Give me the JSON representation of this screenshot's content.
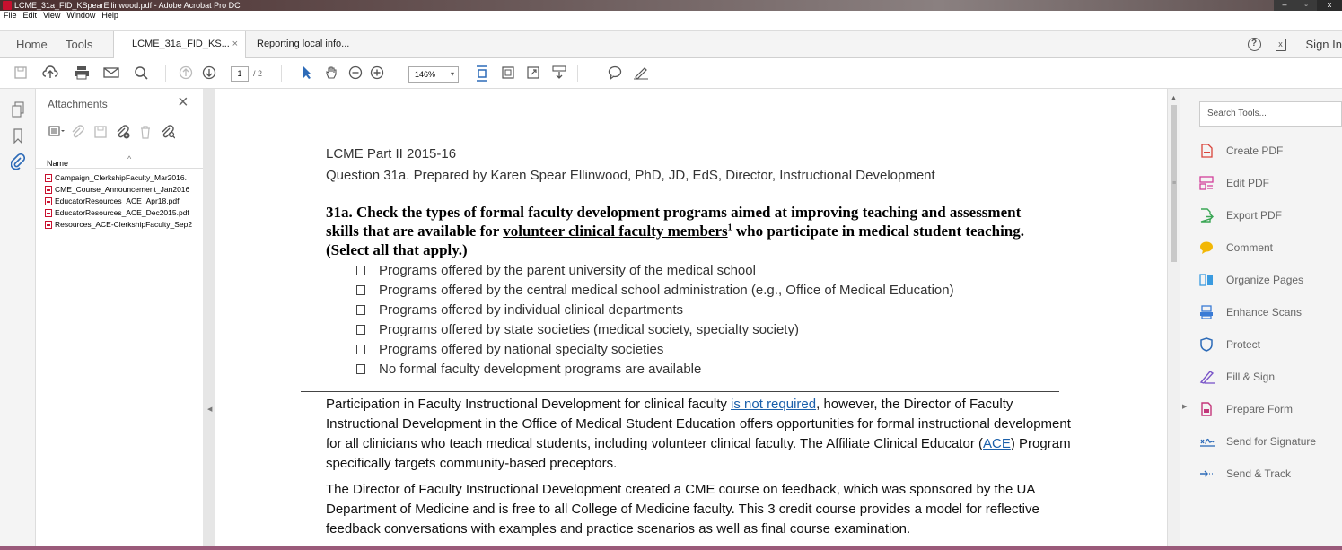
{
  "window": {
    "title": "LCME_31a_FID_KSpearEllinwood.pdf - Adobe Acrobat Pro DC",
    "controls": {
      "minimize": "–",
      "maximize": "▫",
      "close": "x"
    }
  },
  "menu": [
    "File",
    "Edit",
    "View",
    "Window",
    "Help"
  ],
  "tabs": {
    "home": "Home",
    "tools": "Tools",
    "active_doc": "LCME_31a_FID_KS...",
    "active_doc_close": "×",
    "other_doc": "Reporting local info...",
    "sign_in": "Sign In",
    "help_glyph": "?",
    "mobile_glyph": "x"
  },
  "toolbar": {
    "page_current": "1",
    "page_total": "/ 2",
    "zoom": "146%",
    "zoom_caret": "▾"
  },
  "attachments": {
    "title": "Attachments",
    "close": "×",
    "column_name": "Name",
    "sort_glyph": "^",
    "files": [
      "Campaign_ClerkshipFaculty_Mar2016.",
      "CME_Course_Announcement_Jan2016",
      "EducatorResources_ACE_Apr18.pdf",
      "EducatorResources_ACE_Dec2015.pdf",
      "Resources_ACE-ClerkshipFaculty_Sep2"
    ]
  },
  "document": {
    "heading1": "LCME Part II 2015-16",
    "heading2": "Question 31a. Prepared by Karen Spear Ellinwood, PhD, JD, EdS, Director, Instructional Development",
    "question_line1": "31a. Check the types of formal faculty development programs aimed at improving teaching and assessment",
    "question_line2_pre": "skills that are available for ",
    "question_line2_link": "volunteer clinical faculty members",
    "question_line2_sup": "1",
    "question_line2_post": " who participate in medical student teaching.",
    "question_line3": "(Select all that apply.)",
    "options": [
      "Programs offered by the parent university of the medical school",
      "Programs offered by the central medical school administration (e.g., Office of Medical Education)",
      "Programs offered by individual clinical departments",
      "Programs offered by state societies (medical society, specialty society)",
      "Programs offered by national specialty societies",
      "No formal faculty development programs are available"
    ],
    "para1_a": "Participation in Faculty Instructional Development for clinical faculty ",
    "para1_link": "is not required",
    "para1_b": ", however, the Director of Faculty Instructional Development in the Office of Medical Student Education offers opportunities for formal instructional development for all clinicians who teach medical students, including volunteer clinical faculty.  The Affiliate Clinical Educator (",
    "para1_link2": "ACE",
    "para1_c": ") Program specifically targets community-based preceptors.",
    "para2": "The Director of Faculty Instructional Development created a CME course on feedback, which was sponsored by the UA Department of Medicine and is free to all College of Medicine faculty. This 3 credit course provides a model for reflective feedback conversations with examples and practice scenarios as well as final course examination."
  },
  "tools_pane": {
    "search_placeholder": "Search Tools...",
    "items": [
      {
        "label": "Create PDF",
        "color": "#d9443a"
      },
      {
        "label": "Edit PDF",
        "color": "#d3409a"
      },
      {
        "label": "Export PDF",
        "color": "#3aa655"
      },
      {
        "label": "Comment",
        "color": "#f2b705"
      },
      {
        "label": "Organize Pages",
        "color": "#3a9be0"
      },
      {
        "label": "Enhance Scans",
        "color": "#3a7bd5"
      },
      {
        "label": "Protect",
        "color": "#2d6bb8"
      },
      {
        "label": "Fill & Sign",
        "color": "#7a55c8"
      },
      {
        "label": "Prepare Form",
        "color": "#c3367a"
      },
      {
        "label": "Send for Signature",
        "color": "#2d6bb8"
      },
      {
        "label": "Send & Track",
        "color": "#2d6bb8"
      }
    ]
  }
}
